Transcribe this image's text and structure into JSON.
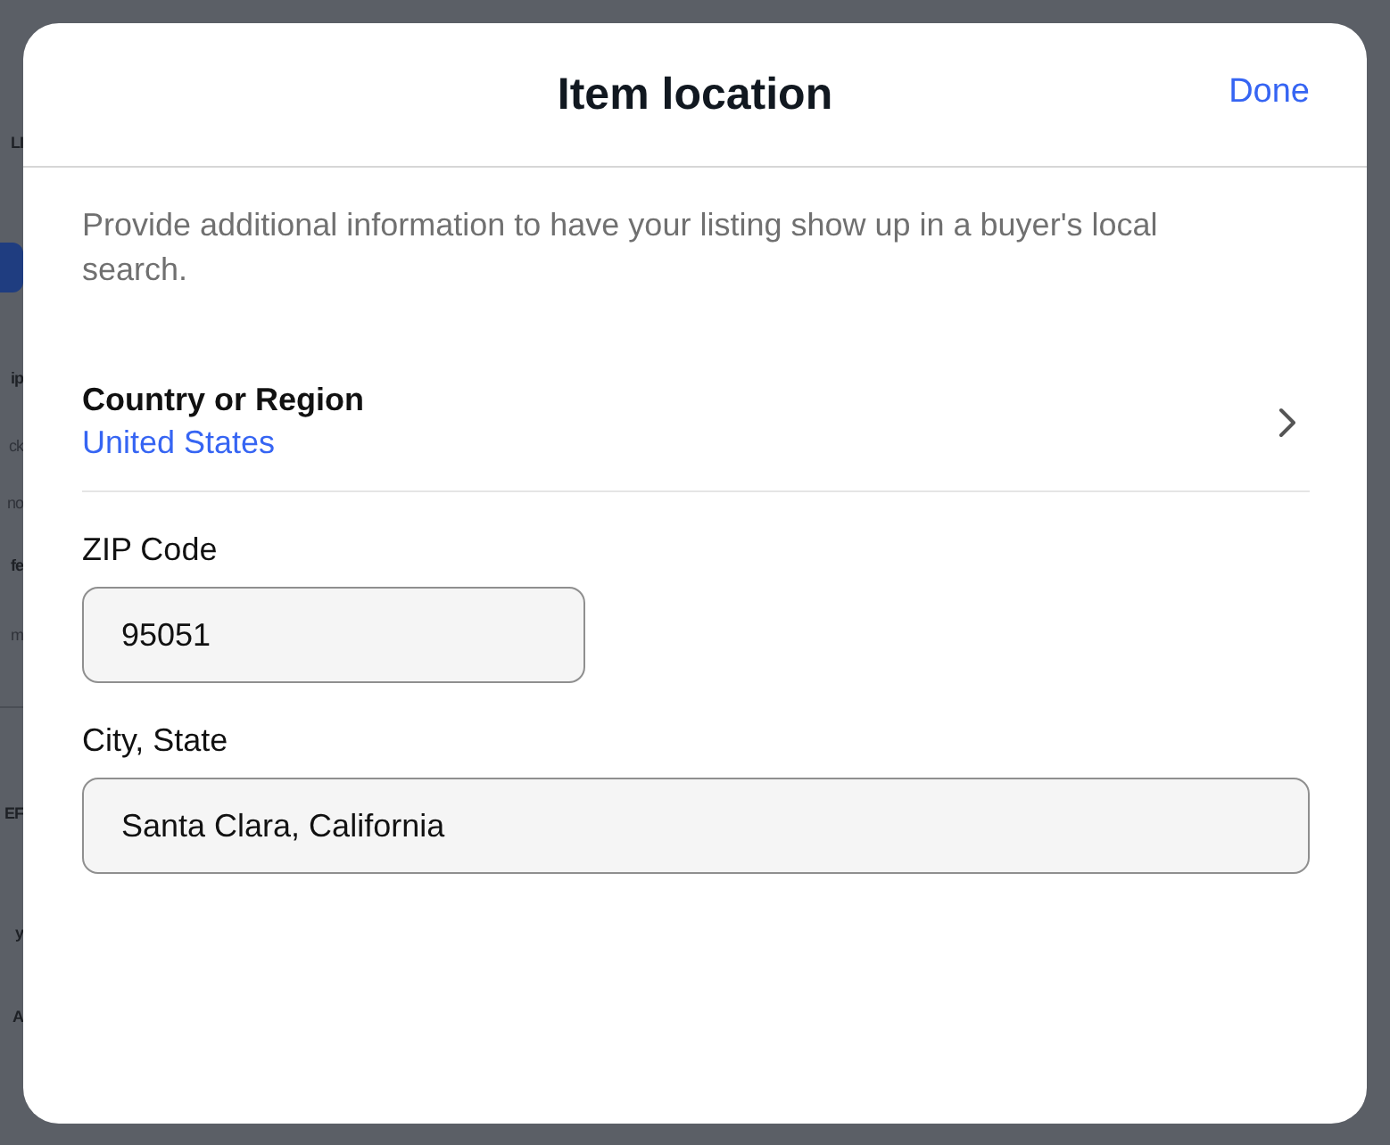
{
  "background_page": {
    "fragments": [
      {
        "text": "LI",
        "kind": "heading"
      },
      {
        "kind": "info-icon"
      },
      {
        "text": "ip",
        "kind": "title"
      },
      {
        "text": "ck",
        "kind": "body"
      },
      {
        "text": "no",
        "kind": "body"
      },
      {
        "text": "fe",
        "kind": "heading"
      },
      {
        "text": "m",
        "kind": "body"
      },
      {
        "kind": "divider"
      },
      {
        "text": "EF",
        "kind": "heading"
      },
      {
        "text": "y",
        "kind": "heading"
      },
      {
        "text": "A",
        "kind": "heading"
      }
    ]
  },
  "dialog": {
    "title": "Item location",
    "done": "Done",
    "description": "Provide additional information to have your listing show up in a buyer's local search.",
    "country": {
      "label": "Country or Region",
      "value": "United States"
    },
    "zip": {
      "label": "ZIP Code",
      "value": "95051"
    },
    "city": {
      "label": "City, State",
      "value": "Santa Clara, California"
    }
  }
}
